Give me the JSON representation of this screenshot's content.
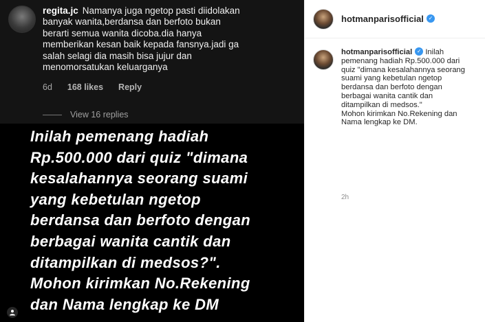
{
  "image_panel": {
    "comment": {
      "username": "regita.jc",
      "text": "Namanya juga ngetop pasti diidolakan banyak wanita,berdansa dan berfoto bukan berarti semua wanita dicoba.dia hanya memberikan kesan baik kepada fansnya.jadi ga salah selagi dia masih bisa jujur dan menomorsatukan keluarganya",
      "age": "6d",
      "likes": "168 likes",
      "reply_label": "Reply"
    },
    "view_replies": "View 16 replies",
    "overlay_text": "Inilah pemenang hadiah\nRp.500.000 dari quiz \"dimana\nkesalahannya seorang suami\nyang kebetulan ngetop\nberdansa dan berfoto dengan\nberbagai wanita cantik dan\nditampilkan di medsos?\".\nMohon kirimkan No.Rekening\ndan Nama lengkap ke DM"
  },
  "header": {
    "username": "hotmanparisofficial"
  },
  "caption": {
    "username": "hotmanparisofficial",
    "text": "Inilah\npemenang hadiah Rp.500.000 dari\nquiz \"dimana kesalahannya seorang\nsuami yang kebetulan ngetop\nberdansa dan berfoto dengan\nberbagai wanita cantik dan\nditampilkan di medsos.\"\nMohon kirimkan No.Rekening dan\nNama lengkap ke DM.",
    "time": "2h"
  },
  "colors": {
    "verified": "#3897f0",
    "image_bg": "#000000"
  },
  "icons": {
    "verified": "verified-badge-icon",
    "user_tag": "user-tag-icon"
  }
}
